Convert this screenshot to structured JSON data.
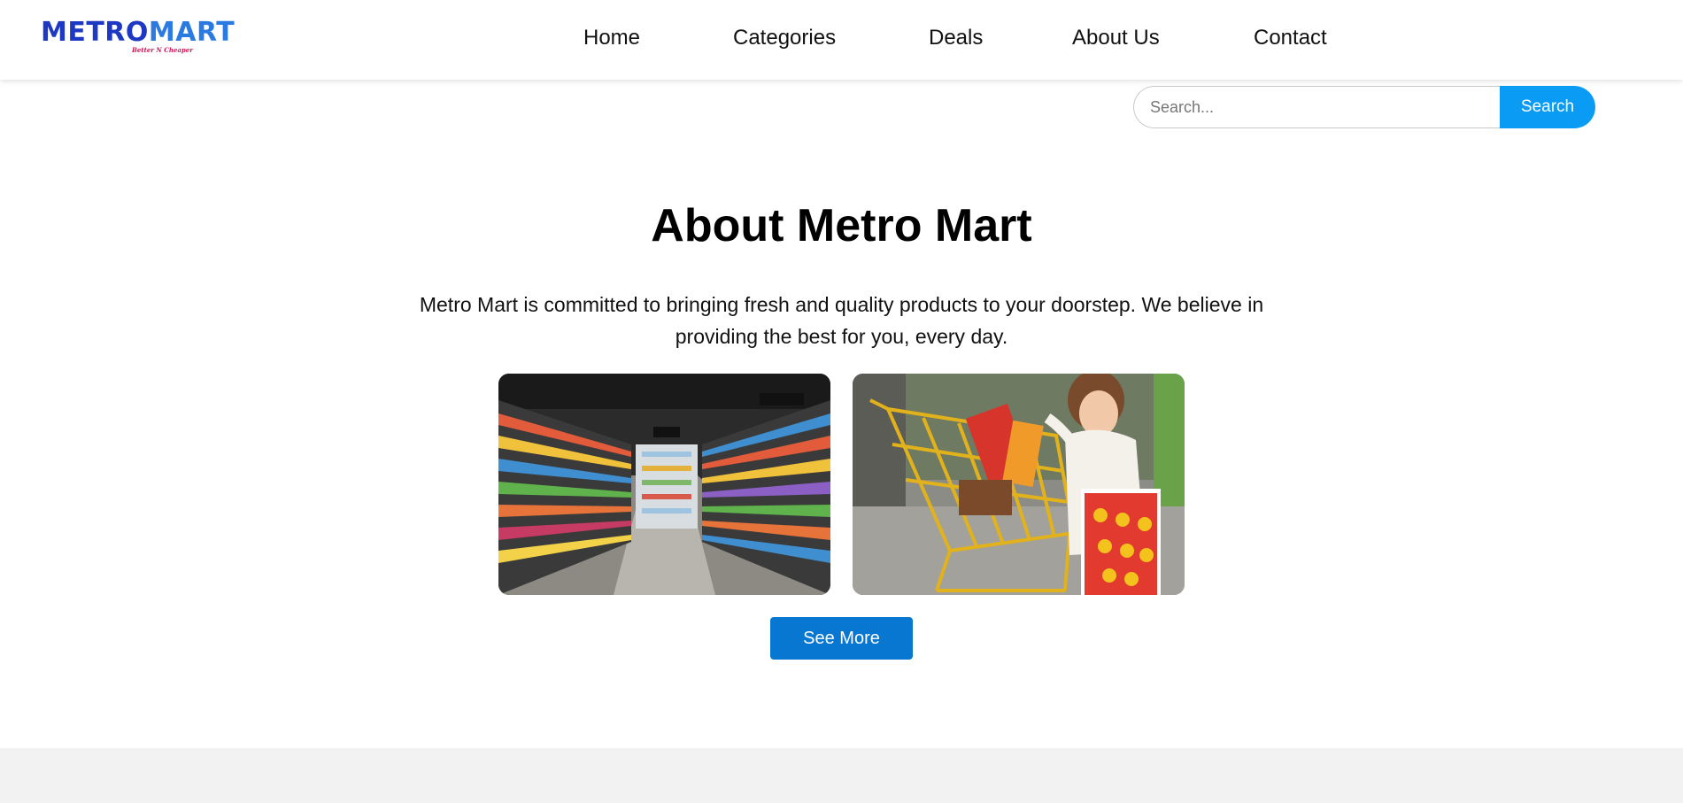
{
  "brand": {
    "logo_part1": "METRO",
    "logo_part2": "MART",
    "tagline": "Better N Cheaper"
  },
  "nav": {
    "items": [
      "Home",
      "Categories",
      "Deals",
      "About Us",
      "Contact"
    ]
  },
  "search": {
    "placeholder": "Search...",
    "value": "",
    "button_label": "Search"
  },
  "about": {
    "title": "About Metro Mart",
    "description": "Metro Mart is committed to bringing fresh and quality products to your doorstep. We believe in providing the best for you, every day.",
    "see_more_label": "See More"
  },
  "colors": {
    "search_button": "#0a9bf5",
    "see_more_button": "#0877d1",
    "logo_dark_blue": "#1d39c4",
    "logo_light_blue": "#2a7ae2",
    "tagline": "#d4145a",
    "footer_band": "#f2f2f2"
  }
}
